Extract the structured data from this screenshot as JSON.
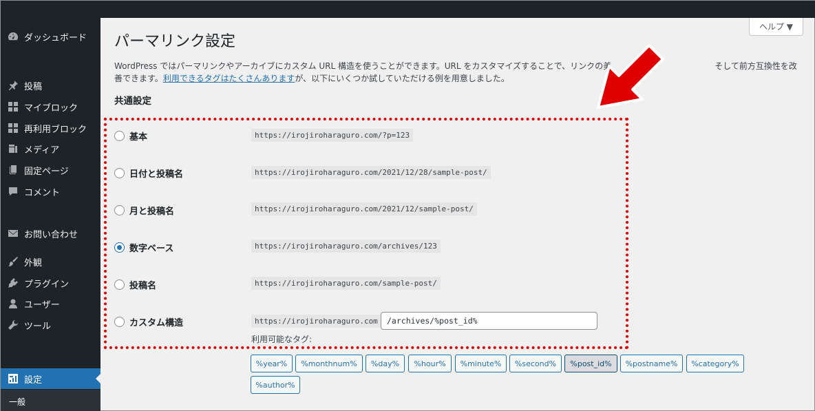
{
  "sidebar": {
    "items": [
      {
        "label": "ダッシュボード",
        "icon": "dashboard-icon"
      },
      {
        "label": "投稿",
        "icon": "pin-icon"
      },
      {
        "label": "マイブロック",
        "icon": "blocks-icon"
      },
      {
        "label": "再利用ブロック",
        "icon": "blocks-icon"
      },
      {
        "label": "メディア",
        "icon": "media-icon"
      },
      {
        "label": "固定ページ",
        "icon": "page-icon"
      },
      {
        "label": "コメント",
        "icon": "comment-icon"
      },
      {
        "label": "お問い合わせ",
        "icon": "mail-icon"
      },
      {
        "label": "外観",
        "icon": "brush-icon"
      },
      {
        "label": "プラグイン",
        "icon": "plugin-icon"
      },
      {
        "label": "ユーザー",
        "icon": "user-icon"
      },
      {
        "label": "ツール",
        "icon": "wrench-icon"
      },
      {
        "label": "設定",
        "icon": "settings-icon"
      }
    ],
    "submenu": {
      "label": "一般"
    }
  },
  "header": {
    "help_label": "ヘルプ ▼",
    "title": "パーマリンク設定"
  },
  "intro": {
    "text_1": "WordPress ではパーマリンクやアーカイブにカスタム URL 構造を使うことができます。URL をカスタマイズすることで、リンクの美",
    "text_2": "そして前方互換性を改善できます。",
    "link": "利用できるタグはたくさんあります",
    "text_3": "が、以下にいくつか試していただける例を用意しました。"
  },
  "common": {
    "section_title": "共通設定",
    "options": [
      {
        "label": "基本",
        "url": "https://irojiroharaguro.com/?p=123",
        "checked": false
      },
      {
        "label": "日付と投稿名",
        "url": "https://irojiroharaguro.com/2021/12/28/sample-post/",
        "checked": false
      },
      {
        "label": "月と投稿名",
        "url": "https://irojiroharaguro.com/2021/12/sample-post/",
        "checked": false
      },
      {
        "label": "数字ベース",
        "url": "https://irojiroharaguro.com/archives/123",
        "checked": true
      },
      {
        "label": "投稿名",
        "url": "https://irojiroharaguro.com/sample-post/",
        "checked": false
      },
      {
        "label": "カスタム構造",
        "url": "https://irojiroharaguro.com",
        "checked": false
      }
    ],
    "custom_value": "/archives/%post_id%",
    "tags_label": "利用可能なタグ:",
    "tags": [
      "%year%",
      "%monthnum%",
      "%day%",
      "%hour%",
      "%minute%",
      "%second%",
      "%post_id%",
      "%postname%",
      "%category%",
      "%author%"
    ],
    "active_tag": "%post_id%"
  },
  "colors": {
    "sidebar_bg": "#1d2327",
    "accent": "#2271b1",
    "highlight": "#e00000"
  }
}
